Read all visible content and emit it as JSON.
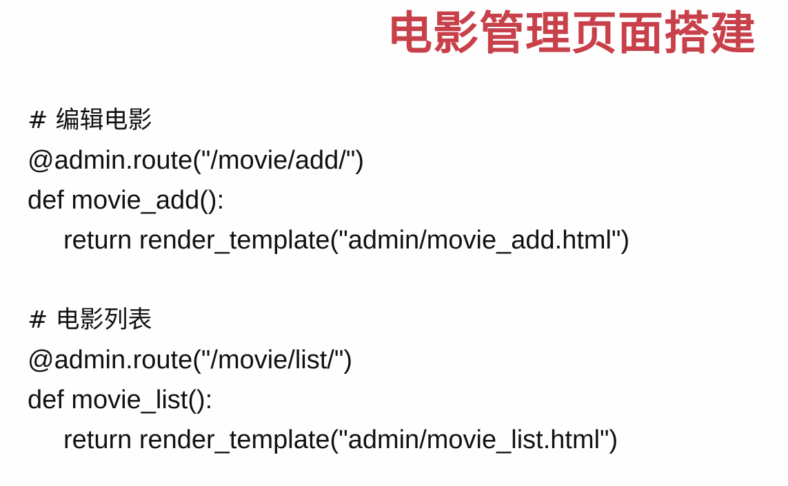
{
  "slide": {
    "title": "电影管理页面搭建",
    "title_color": "#c8404a",
    "text_color": "#111111",
    "background_color": "#fefefe"
  },
  "code_groups": [
    {
      "comment": "# 编辑电影",
      "decorator": "@admin.route(\"/movie/add/\")",
      "def_line": "def movie_add():",
      "return_line": "return render_template(\"admin/movie_add.html\")"
    },
    {
      "comment": "# 电影列表",
      "decorator": "@admin.route(\"/movie/list/\")",
      "def_line": "def movie_list():",
      "return_line": "return render_template(\"admin/movie_list.html\")"
    }
  ]
}
